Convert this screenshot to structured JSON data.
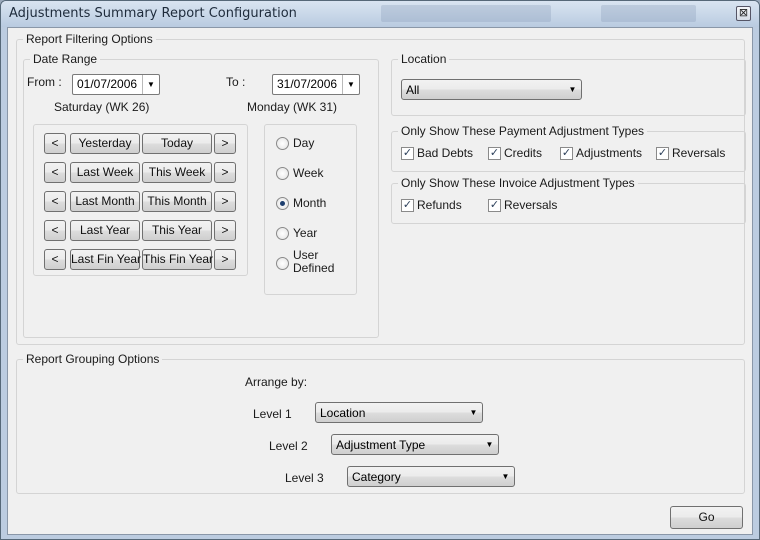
{
  "window": {
    "title": "Adjustments Summary Report Configuration",
    "close_glyph": "⊠"
  },
  "filtering": {
    "title": "Report Filtering Options",
    "date_range": {
      "title": "Date Range",
      "from_label": "From :",
      "from_value": "01/07/2006",
      "from_day": "Saturday (WK 26)",
      "to_label": "To :",
      "to_value": "31/07/2006",
      "to_day": "Monday (WK 31)",
      "prev_glyph": "<",
      "next_glyph": ">",
      "quick_buttons": [
        [
          "Yesterday",
          "Today"
        ],
        [
          "Last Week",
          "This Week"
        ],
        [
          "Last Month",
          "This Month"
        ],
        [
          "Last Year",
          "This Year"
        ],
        [
          "Last Fin Year",
          "This Fin Year"
        ]
      ],
      "period_options": [
        "Day",
        "Week",
        "Month",
        "Year",
        "User\nDefined"
      ],
      "selected_period": "Month"
    },
    "location": {
      "title": "Location",
      "value": "All"
    },
    "payment_types": {
      "title": "Only Show These Payment Adjustment Types",
      "items": [
        {
          "label": "Bad Debts",
          "checked": true
        },
        {
          "label": "Credits",
          "checked": true
        },
        {
          "label": "Adjustments",
          "checked": true
        },
        {
          "label": "Reversals",
          "checked": true
        }
      ]
    },
    "invoice_types": {
      "title": "Only Show These Invoice Adjustment Types",
      "items": [
        {
          "label": "Refunds",
          "checked": true
        },
        {
          "label": "Reversals",
          "checked": true
        }
      ]
    }
  },
  "grouping": {
    "title": "Report Grouping Options",
    "arrange_label": "Arrange by:",
    "levels": [
      {
        "label": "Level 1",
        "value": "Location"
      },
      {
        "label": "Level 2",
        "value": "Adjustment Type"
      },
      {
        "label": "Level 3",
        "value": "Category"
      }
    ]
  },
  "actions": {
    "go_label": "Go"
  }
}
